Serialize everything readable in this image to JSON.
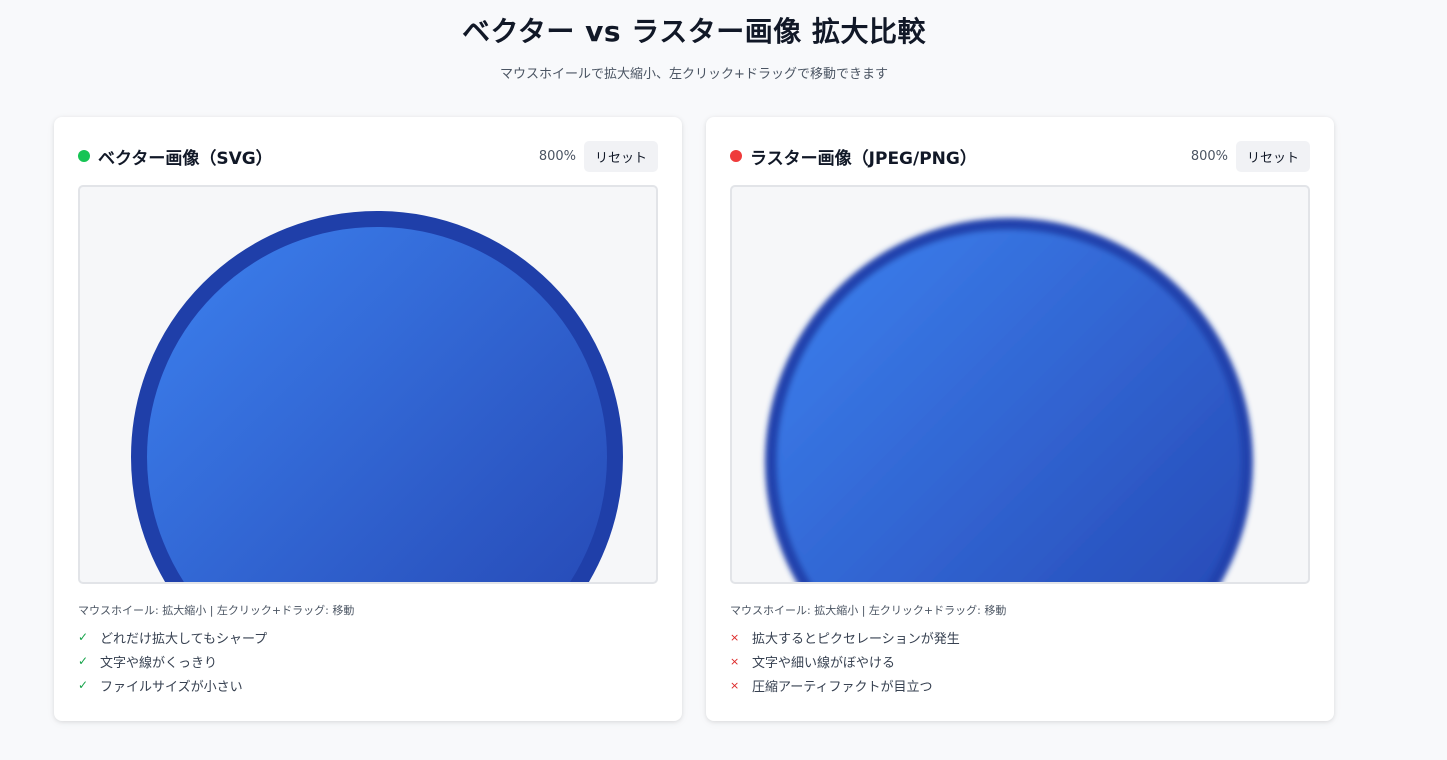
{
  "header": {
    "title": "ベクター vs ラスター画像 拡大比較",
    "subtitle": "マウスホイールで拡大縮小、左クリック+ドラッグで移動できます"
  },
  "colors": {
    "vector_dot": "#16c454",
    "raster_dot": "#ef3b3b",
    "circle_fill_start": "#3b7ded",
    "circle_fill_end": "#2447b4",
    "circle_stroke": "#1f3fa9"
  },
  "panels": [
    {
      "title": "ベクター画像（SVG）",
      "zoom": "800%",
      "reset_label": "リセット",
      "hint": "マウスホイール: 拡大縮小 | 左クリック+ドラッグ: 移動",
      "features": [
        {
          "mark": "✓",
          "text": "どれだけ拡大してもシャープ"
        },
        {
          "mark": "✓",
          "text": "文字や線がくっきり"
        },
        {
          "mark": "✓",
          "text": "ファイルサイズが小さい"
        }
      ]
    },
    {
      "title": "ラスター画像（JPEG/PNG）",
      "zoom": "800%",
      "reset_label": "リセット",
      "hint": "マウスホイール: 拡大縮小 | 左クリック+ドラッグ: 移動",
      "features": [
        {
          "mark": "×",
          "text": "拡大するとピクセレーションが発生"
        },
        {
          "mark": "×",
          "text": "文字や細い線がぼやける"
        },
        {
          "mark": "×",
          "text": "圧縮アーティファクトが目立つ"
        }
      ]
    }
  ]
}
